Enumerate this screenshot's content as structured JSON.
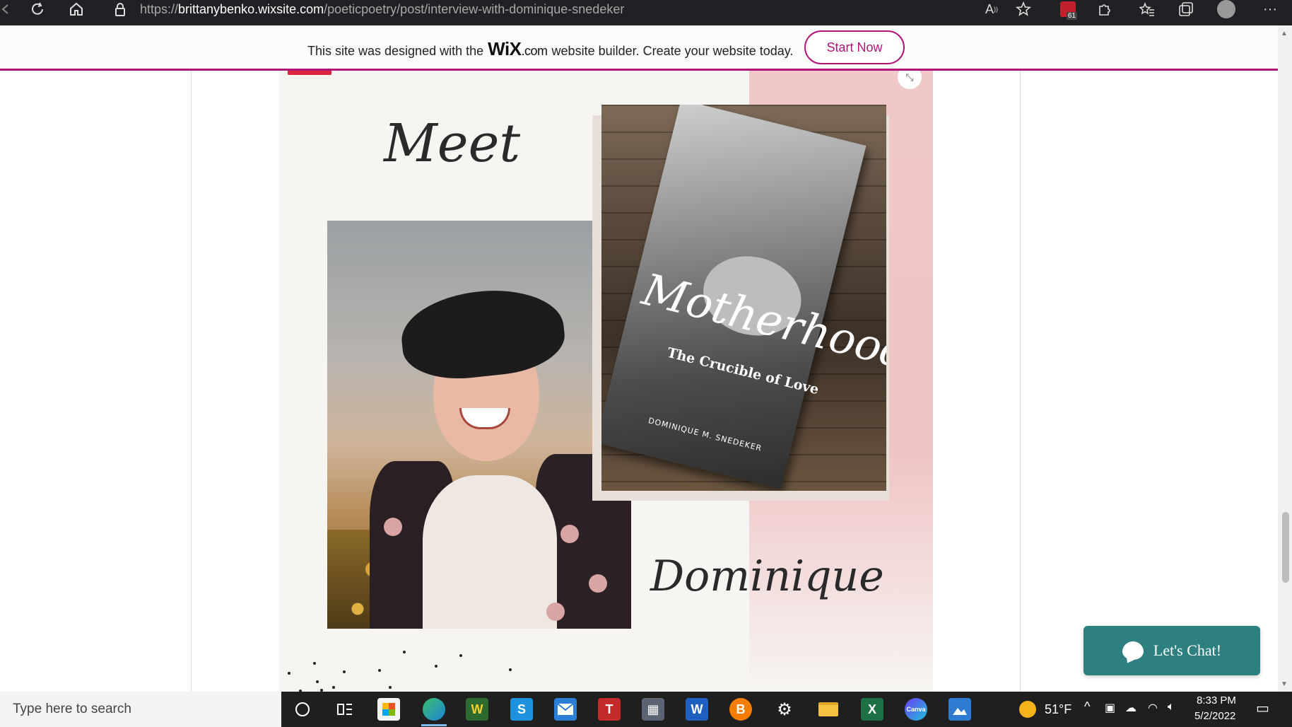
{
  "browser": {
    "url_scheme": "https://",
    "url_host": "brittanybenko.wixsite.com",
    "url_path": "/poeticpoetry/post/interview-with-dominique-snedeker",
    "extension_badge": "61"
  },
  "wix_banner": {
    "text_before": "This site was designed with the",
    "logo_main": "WiX",
    "logo_suffix": ".com",
    "text_after": "website builder. Create your website today.",
    "button_label": "Start Now",
    "accent_color": "#b1127a"
  },
  "post": {
    "meet_text": "Meet",
    "name_text": "Dominique",
    "book": {
      "title": "Motherhood",
      "subtitle": "The Crucible of Love",
      "author": "DOMINIQUE M. SNEDEKER"
    }
  },
  "chat": {
    "label": "Let's Chat!",
    "color": "#2d7f80"
  },
  "taskbar": {
    "search_placeholder": "Type here to search",
    "weather": "51°F",
    "time": "8:33 PM",
    "date": "5/2/2022"
  }
}
